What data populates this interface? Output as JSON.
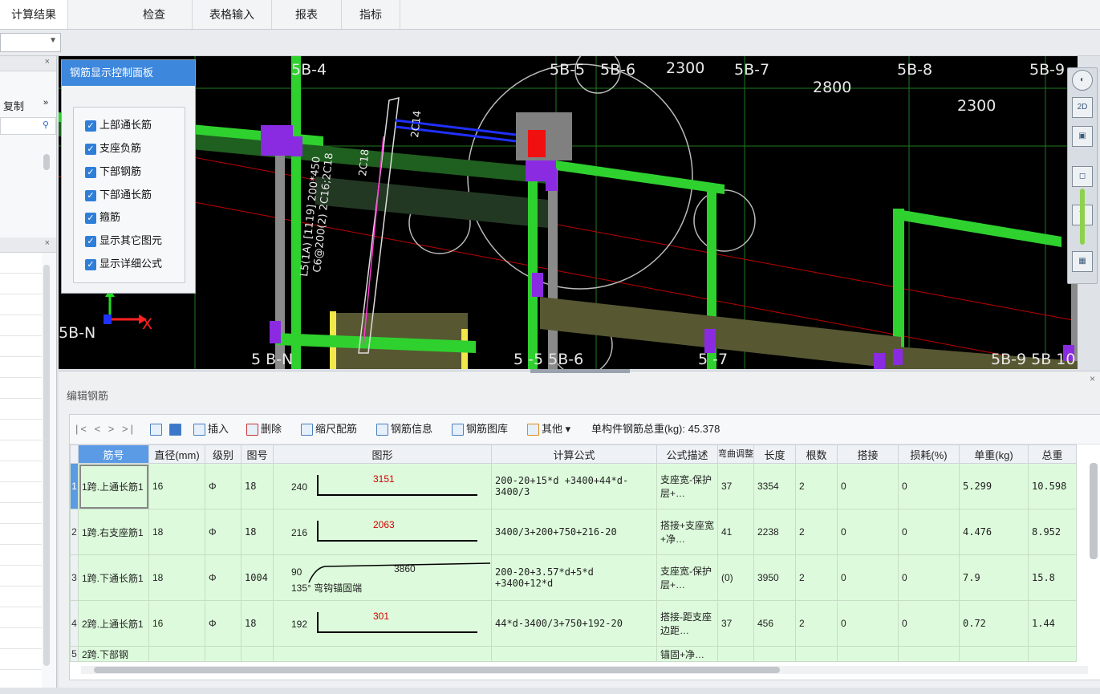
{
  "topbar": {
    "menus": [
      "计算结果",
      "检查",
      "表格输入",
      "报表",
      "指标"
    ]
  },
  "left_panel": {
    "item_label": "复制",
    "chevrons": "»"
  },
  "viewport": {
    "control_panel": {
      "title": "钢筋显示控制面板",
      "options": [
        "上部通长筋",
        "支座负筋",
        "下部钢筋",
        "下部通长筋",
        "箍筋",
        "显示其它图元",
        "显示详细公式"
      ]
    },
    "axis_labels_top": [
      "5B-4",
      "5B-5",
      "5B-6",
      "2300",
      "5B-7",
      "2800",
      "5B-8",
      "2300",
      "5B-9"
    ],
    "axis_labels_bottom": [
      "5B-N",
      "5B-5",
      "5B-6",
      "5B-7",
      "5B-9",
      "5B-10"
    ],
    "beam_annotation": [
      "L5(1A) [1119] 200*450",
      "C6@200(2) 2C16;2C18",
      "2C18"
    ],
    "rebar_label": "2C14",
    "axis_x": "X"
  },
  "editor": {
    "title": "编辑钢筋",
    "toolbar": {
      "nav": "|< < > >|",
      "insert": "插入",
      "delete": "删除",
      "scale": "缩尺配筋",
      "info": "钢筋信息",
      "library": "钢筋图库",
      "other": "其他",
      "total_weight_label": "单构件钢筋总重(kg): 45.378"
    },
    "columns": [
      "筋号",
      "直径(mm)",
      "级别",
      "图号",
      "图形",
      "计算公式",
      "公式描述",
      "弯曲调整",
      "长度",
      "根数",
      "搭接",
      "损耗(%)",
      "单重(kg)",
      "总重"
    ],
    "rows": [
      {
        "no": "1",
        "name": "1跨.上通长筋1",
        "dia": "16",
        "grade": "Φ",
        "fig": "18",
        "left": "240",
        "mid": "3151",
        "formula": "200-20+15*d +3400+44*d-3400/3",
        "desc": "支座宽-保护层+…",
        "bend": "37",
        "len": "3354",
        "count": "2",
        "lap": "0",
        "loss": "0",
        "unit": "5.299",
        "total": "10.598"
      },
      {
        "no": "2",
        "name": "1跨.右支座筋1",
        "dia": "18",
        "grade": "Φ",
        "fig": "18",
        "left": "216",
        "mid": "2063",
        "formula": "3400/3+200+750+216-20",
        "desc": "搭接+支座宽+净…",
        "bend": "41",
        "len": "2238",
        "count": "2",
        "lap": "0",
        "loss": "0",
        "unit": "4.476",
        "total": "8.952"
      },
      {
        "no": "3",
        "name": "1跨.下通长筋1",
        "dia": "18",
        "grade": "Φ",
        "fig": "1004",
        "left": "90",
        "mid": "3860",
        "note": "135° 弯钩锚固端",
        "formula": "200-20+3.57*d+5*d +3400+12*d",
        "desc": "支座宽-保护层+…",
        "bend": "(0)",
        "len": "3950",
        "count": "2",
        "lap": "0",
        "loss": "0",
        "unit": "7.9",
        "total": "15.8"
      },
      {
        "no": "4",
        "name": "2跨.上通长筋1",
        "dia": "16",
        "grade": "Φ",
        "fig": "18",
        "left": "192",
        "mid": "301",
        "formula": "44*d-3400/3+750+192-20",
        "desc": "搭接-距支座边距…",
        "bend": "37",
        "len": "456",
        "count": "2",
        "lap": "0",
        "loss": "0",
        "unit": "0.72",
        "total": "1.44"
      },
      {
        "no": "5",
        "name": "2跨.下部钢",
        "dia": "",
        "grade": "",
        "fig": "",
        "left": "",
        "mid": "",
        "formula": "",
        "desc": "锚固+净…",
        "bend": "",
        "len": "",
        "count": "",
        "lap": "",
        "loss": "",
        "unit": "",
        "total": ""
      }
    ]
  }
}
